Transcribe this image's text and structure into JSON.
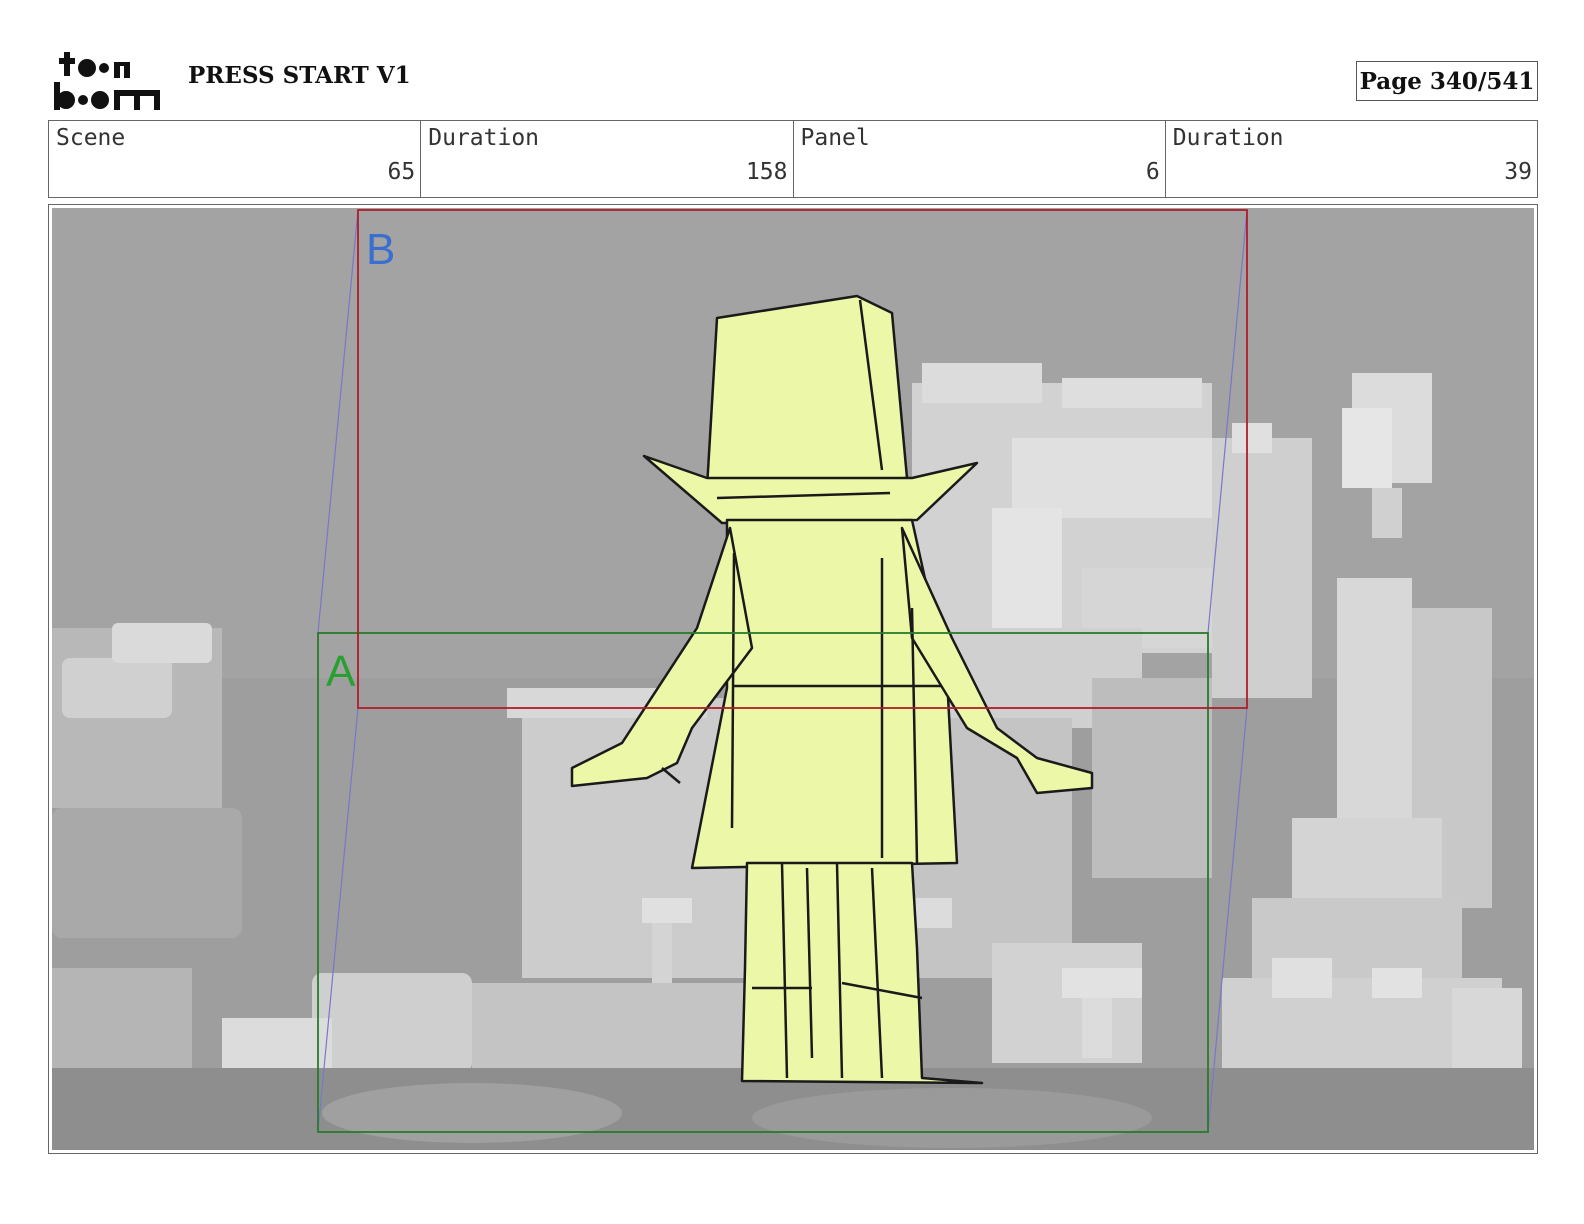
{
  "header": {
    "logo_text": "toon boom",
    "project_title": "PRESS START V1",
    "page_label": "Page 340/541"
  },
  "info": [
    {
      "label": "Scene",
      "value": "65"
    },
    {
      "label": "Duration",
      "value": "158"
    },
    {
      "label": "Panel",
      "value": "6"
    },
    {
      "label": "Duration",
      "value": "39"
    }
  ],
  "panel": {
    "frame_b_label": "B",
    "frame_a_label": "A",
    "colors": {
      "background": "#9e9e9e",
      "buildings": "#d4d4d4",
      "character_fill": "#ecf7a8",
      "frame_b": "#b01c2a",
      "frame_a": "#2a7a2a",
      "frame_b_label": "#3a6fd0",
      "frame_a_label": "#27a030",
      "camera_lines": "#7878c8"
    }
  }
}
